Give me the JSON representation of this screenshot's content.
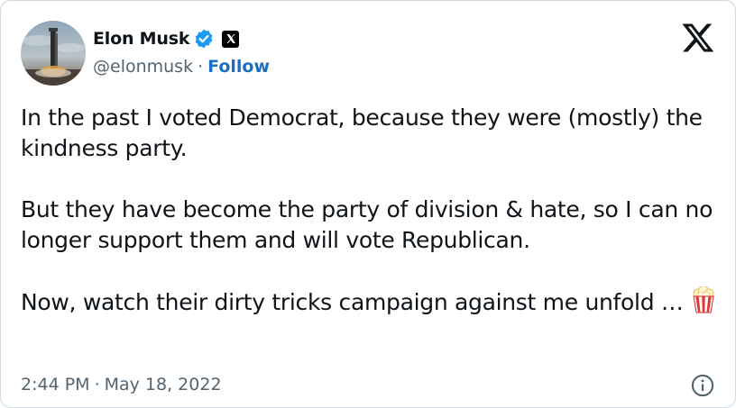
{
  "author": {
    "display_name": "Elon Musk",
    "handle": "@elonmusk",
    "separator": "·",
    "follow_label": "Follow",
    "verified_badge_icon": "verified-check-icon",
    "affiliate_badge_icon": "x-affiliate-badge-icon",
    "avatar": "avatar-rocket-launch-image"
  },
  "platform_logo": "x-logo-icon",
  "tweet": {
    "paragraphs": [
      "In the past I voted Democrat, because they were (mostly) the kindness party.",
      "But they have become the party of division & hate, so I can no longer support them and will vote Republican.",
      "Now, watch their dirty tricks campaign against me unfold …"
    ],
    "trailing_emoji_icon": "popcorn-icon"
  },
  "footer": {
    "time": "2:44 PM",
    "separator": "·",
    "date": "May 18, 2022",
    "info_icon": "info-icon"
  },
  "colors": {
    "text_primary": "#0f1419",
    "text_secondary": "#536471",
    "link": "#1d6ec2",
    "verified_blue": "#1d9bf0",
    "border": "#cfd9de"
  }
}
